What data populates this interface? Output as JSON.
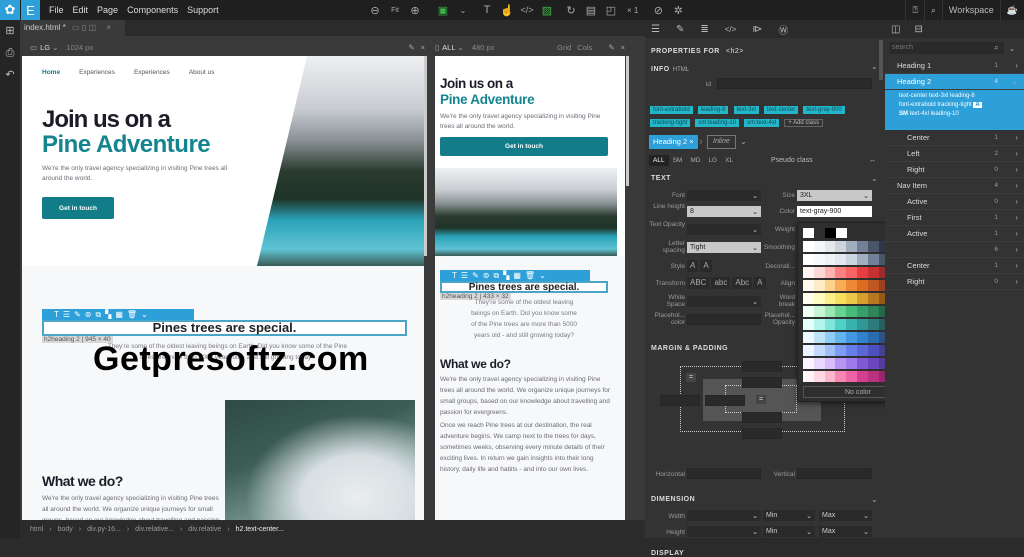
{
  "menubar": {
    "items": [
      "File",
      "Edit",
      "Page",
      "Components",
      "Support"
    ],
    "zoom_fit": "Fit",
    "multiplier": "× 1",
    "workspace": "Workspace"
  },
  "editor": {
    "tab": "index.html *",
    "vp1": {
      "size": "LG",
      "width": "1024 px"
    },
    "vp2": {
      "size": "ALL",
      "width": "480 px",
      "grid": "Grid",
      "cols": "Cols"
    }
  },
  "page": {
    "nav": [
      "Home",
      "Experiences",
      "Experiences",
      "About us"
    ],
    "title_line1": "Join us on a",
    "title_line2": "Pine Adventure",
    "lead": "We're the only travel agency specializing in visiting Pine trees all around the world.",
    "cta": "Get in touch",
    "h2": "Pines trees are special.",
    "h2_label_lg": "h2heading 2 | 945 × 40",
    "h2_label_sm": "h2heading 2 | 433 × 32",
    "h2_para": "They're some of the oldest leaving beings on Earth. Did you know some of the Pine trees are more than 5000 years old - and still growing today?",
    "what_title": "What we do?",
    "what_p1": "We're the only travel agency specializing in visiting Pine trees all around the world. We organize unique journeys for small groups, based on our knowledge about travelling and passion for evergreens.",
    "what_p2": "Once we reach Pine trees at our destination, the real adventure begins. We camp next to the trees for days, sometimes weeks, observing every minute details of their exciting lives. In return we gain insights into their long history, daily life and habits - and into our own lives."
  },
  "watermark": "Getpresoftz.com",
  "breadcrumb": [
    "html",
    "body",
    "div.py-16...",
    "div.relative...",
    "div.relative",
    "h2.text-center..."
  ],
  "props": {
    "title": "PROPERTIES FOR",
    "tag": "<h2>",
    "info": "INFO",
    "info_sub": "HTML",
    "id_label": "Id",
    "classes": [
      "font-extrabold",
      "leading-8",
      "text-3xl",
      "text-center",
      "text-gray-900",
      "tracking-tight",
      "sm:leading-10",
      "sm:text-4xl"
    ],
    "add_class": "+ Add class",
    "selector": "Heading 2",
    "inline": "Inline",
    "breakpoints": [
      "ALL",
      "SM",
      "MD",
      "LG",
      "XL"
    ],
    "pseudo": "Pseudo class",
    "text_section": "TEXT",
    "labels": {
      "font": "Font",
      "line_height": "Line height",
      "text_opacity": "Text Opacity",
      "letter_spacing": "Letter spacing",
      "style": "Style",
      "transform": "Transform",
      "white_space": "White Space",
      "placeholder_color": "Placehol... color",
      "size": "Size",
      "color": "Color",
      "weight": "Weight",
      "smoothing": "Smoothing",
      "decoration": "Decorati...",
      "align": "Align",
      "word_break": "Word break",
      "placeholder_opacity": "Placehol... Opacity"
    },
    "values": {
      "size": "3XL",
      "color": "text-gray-900",
      "line_height": "8",
      "letter_spacing": "Tight"
    },
    "style_btns": [
      "A",
      "A"
    ],
    "transform_btns": [
      "ABC",
      "abc",
      "Abc",
      "A"
    ],
    "margin_section": "MARGIN & PADDING",
    "horizontal": "Horizontal",
    "vertical": "Vertical",
    "dimension_section": "DIMENSION",
    "width": "Width",
    "height": "Height",
    "min": "Min",
    "max": "Max",
    "display_section": "DISPLAY",
    "no_color": "No color"
  },
  "palette": [
    [
      "#ffffff",
      "#f4f6f8",
      "#e4e8ed",
      "#cdd4dc",
      "#a0aec0",
      "#718096",
      "#4a5568",
      "#2d3748",
      "#1a202c",
      "#171923"
    ],
    [
      "#ffffff",
      "#f7fafc",
      "#edf2f7",
      "#e2e8f0",
      "#cbd5e0",
      "#a0aec0",
      "#718096",
      "#4a5568",
      "#2d3748",
      "#1a202c"
    ],
    [
      "#fff5f5",
      "#fed7d7",
      "#feb2b2",
      "#fc8181",
      "#f56565",
      "#e53e3e",
      "#c53030",
      "#9b2c2c",
      "#742a2a",
      "#63171b"
    ],
    [
      "#fffaf0",
      "#feebc8",
      "#fbd38d",
      "#f6ad55",
      "#ed8936",
      "#dd6b20",
      "#c05621",
      "#9c4221",
      "#7b341e",
      "#652b19"
    ],
    [
      "#fffff0",
      "#fefcbf",
      "#faf089",
      "#f6e05e",
      "#ecc94b",
      "#d69e2e",
      "#b7791f",
      "#975a16",
      "#744210",
      "#5f370e"
    ],
    [
      "#f0fff4",
      "#c6f6d5",
      "#9ae6b4",
      "#68d391",
      "#48bb78",
      "#38a169",
      "#2f855a",
      "#276749",
      "#22543d",
      "#1c4532"
    ],
    [
      "#e6fffa",
      "#b2f5ea",
      "#81e6d9",
      "#4fd1c5",
      "#38b2ac",
      "#319795",
      "#2c7a7b",
      "#285e61",
      "#234e52",
      "#1d4044"
    ],
    [
      "#ebf8ff",
      "#bee3f8",
      "#90cdf4",
      "#63b3ed",
      "#4299e1",
      "#3182ce",
      "#2b6cb0",
      "#2c5282",
      "#2a4365",
      "#1a365d"
    ],
    [
      "#ebf4ff",
      "#c3dafe",
      "#a3bffa",
      "#7f9cf5",
      "#667eea",
      "#5a67d8",
      "#4c51bf",
      "#434190",
      "#3c366b",
      "#2c2a5a"
    ],
    [
      "#faf5ff",
      "#e9d8fd",
      "#d6bcfa",
      "#b794f4",
      "#9f7aea",
      "#805ad5",
      "#6b46c1",
      "#553c9a",
      "#44337a",
      "#322659"
    ],
    [
      "#fff5f7",
      "#fed7e2",
      "#fbb6ce",
      "#f687b3",
      "#ed64a6",
      "#d53f8c",
      "#b83280",
      "#97266d",
      "#702459",
      "#521b41"
    ]
  ],
  "selectors_panel": {
    "search_placeholder": "search",
    "items": [
      {
        "label": "Heading 1",
        "count": "1",
        "indent": false,
        "selected": false
      },
      {
        "label": "Heading 2",
        "count": "4",
        "indent": false,
        "selected": true
      },
      {
        "label": "Center",
        "count": "1",
        "indent": true,
        "selected": false
      },
      {
        "label": "Left",
        "count": "2",
        "indent": true,
        "selected": false
      },
      {
        "label": "Right",
        "count": "0",
        "indent": true,
        "selected": false
      },
      {
        "label": "Nav Item",
        "count": "4",
        "indent": false,
        "selected": false
      },
      {
        "label": "Active",
        "count": "0",
        "indent": true,
        "selected": false
      },
      {
        "label": "First",
        "count": "1",
        "indent": true,
        "selected": false
      },
      {
        "label": "Active",
        "count": "1",
        "indent": true,
        "selected": false
      },
      {
        "label": "",
        "count": "6",
        "indent": false,
        "selected": false
      },
      {
        "label": "Center",
        "count": "1",
        "indent": true,
        "selected": false
      },
      {
        "label": "Right",
        "count": "0",
        "indent": true,
        "selected": false
      }
    ],
    "selected_detail": {
      "line1": "text-center  text-3xl  leading-8",
      "line2": "font-extrabold  tracking-tight",
      "badge": "A",
      "sm": "SM",
      "line3": "text-4xl  leading-10"
    }
  }
}
